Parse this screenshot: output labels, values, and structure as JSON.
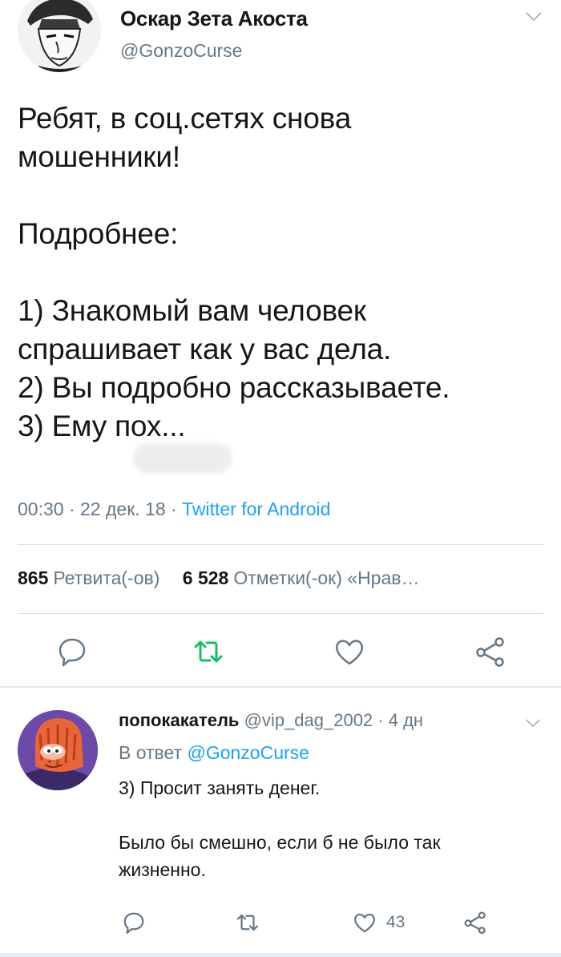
{
  "tweet": {
    "author_name": "Оскар Зета Акоста",
    "author_handle": "@GonzoCurse",
    "text": "Ребят, в соц.сетях снова\nмошенники!\n\nПодробнее:\n\n1) Знакомый вам человек\nспрашивает как у вас дела.\n2) Вы подробно рассказываете.\n3) Ему пох...",
    "time": "00:30",
    "date": "22 дек. 18",
    "client": "Twitter for Android",
    "retweets_count": "865",
    "retweets_label": "Ретвита(-ов)",
    "likes_count": "6 528",
    "likes_label": "Отметки(-ок)",
    "likes_more": "«Нрав…"
  },
  "reply": {
    "author_name": "попокакатель",
    "author_handle": "@vip_dag_2002",
    "age": "4 дн",
    "reply_prefix": "В ответ",
    "reply_to": "@GonzoCurse",
    "text": "3) Просит занять денег.\n\nБыло бы смешно, если б не было так\nжизненно.",
    "like_count": "43"
  },
  "separator": "·",
  "colors": {
    "link": "#1da1f2",
    "muted": "#657786",
    "retweet_active": "#17bf63",
    "text": "#14171a"
  },
  "icons": [
    "chevron-down-icon",
    "reply-icon",
    "retweet-icon",
    "like-icon",
    "share-icon"
  ]
}
